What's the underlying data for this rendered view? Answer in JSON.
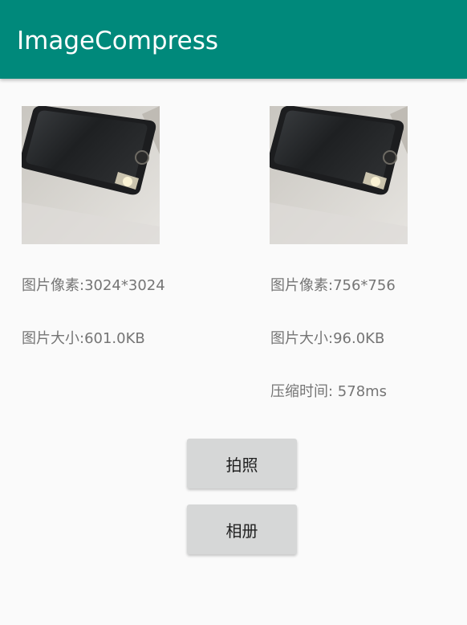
{
  "app": {
    "title": "ImageCompress",
    "primary_color": "#00897b",
    "status_color": "#00675b"
  },
  "original": {
    "image_icon": "phone-photo",
    "pixels": "图片像素:3024*3024",
    "size": "图片大小:601.0KB"
  },
  "compressed": {
    "image_icon": "phone-photo",
    "pixels": "图片像素:756*756",
    "size": "图片大小:96.0KB",
    "time": "压缩时间: 578ms"
  },
  "buttons": {
    "camera_label": "拍照",
    "album_label": "相册"
  }
}
